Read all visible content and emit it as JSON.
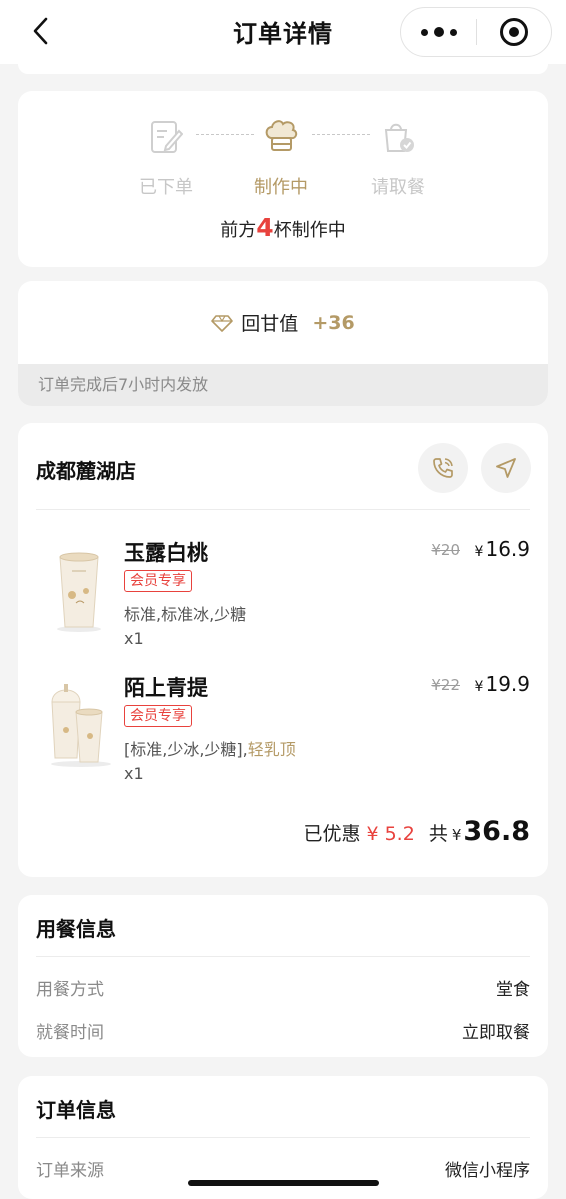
{
  "nav": {
    "title": "订单详情",
    "back_icon": "chevron-left-icon",
    "more_icon": "more-dots-icon",
    "close_icon": "target-close-icon"
  },
  "progress": {
    "steps": [
      {
        "label": "已下单",
        "icon": "order-placed-icon",
        "state": "done"
      },
      {
        "label": "制作中",
        "icon": "chef-hat-icon",
        "state": "active"
      },
      {
        "label": "请取餐",
        "icon": "pickup-bag-icon",
        "state": "pending"
      }
    ],
    "queue_prefix": "前方",
    "queue_count": "4",
    "queue_suffix": "杯制作中"
  },
  "points": {
    "icon": "diamond-icon",
    "label": "回甘值",
    "value": "+36",
    "note": "订单完成后7小时内发放"
  },
  "store": {
    "name": "成都麓湖店",
    "call_icon": "phone-icon",
    "nav_icon": "navigate-arrow-icon",
    "items": [
      {
        "name": "玉露白桃",
        "badge": "会员专享",
        "spec": "标准,标准冰,少糖",
        "spec_extra": "",
        "qty": "x1",
        "original_price": "¥20",
        "currency": "¥",
        "price": "16.9"
      },
      {
        "name": "陌上青提",
        "badge": "会员专享",
        "spec": "[标准,少冰,少糖],",
        "spec_extra": "轻乳顶",
        "qty": "x1",
        "original_price": "¥22",
        "currency": "¥",
        "price": "19.9"
      }
    ],
    "discount_label": "已优惠",
    "discount_value": "¥ 5.2",
    "total_label": "共",
    "total_currency": "¥",
    "total_value": "36.8"
  },
  "dining": {
    "title": "用餐信息",
    "rows": [
      {
        "key": "用餐方式",
        "value": "堂食"
      },
      {
        "key": "就餐时间",
        "value": "立即取餐"
      }
    ]
  },
  "order_info": {
    "title": "订单信息",
    "rows": [
      {
        "key": "订单来源",
        "value": "微信小程序"
      }
    ]
  },
  "colors": {
    "accent_gold": "#b49a66",
    "accent_red": "#e8423d",
    "inactive_gray": "#c7c7c7",
    "page_bg": "#f4f4f4"
  }
}
